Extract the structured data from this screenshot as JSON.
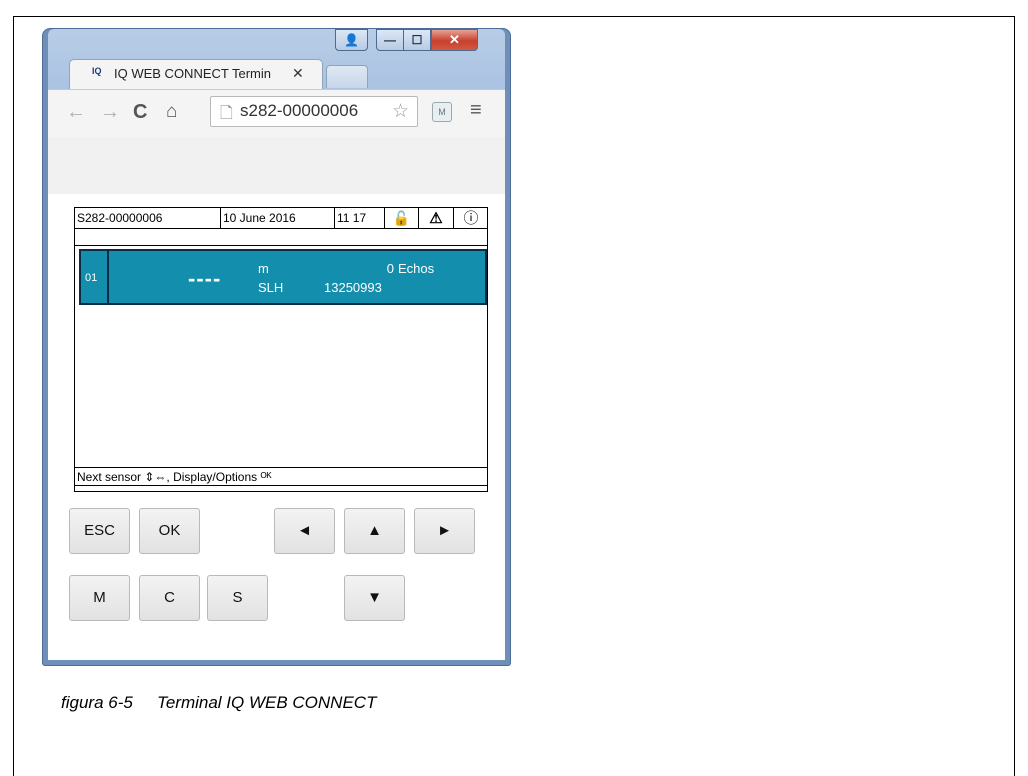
{
  "browser": {
    "tab_title": "IQ WEB CONNECT Termin",
    "favicon_text": "IQ",
    "url": "s282-00000006",
    "window_controls": [
      "user-icon",
      "minimize-icon",
      "maximize-icon",
      "close-icon"
    ]
  },
  "terminal": {
    "header": {
      "device_id": "S282-00000006",
      "date": "10 June 2016",
      "time": "11 17"
    },
    "sensor": {
      "number": "01",
      "value": "----",
      "unit_main": "m",
      "unit_sub": "SLH",
      "reading_main": "0",
      "reading_label": "Echos",
      "serial": "13250993"
    },
    "footer_text": "Next sensor ⇕⇔, Display/Options ᴼᴷ"
  },
  "keys": {
    "esc": "ESC",
    "ok": "OK",
    "left": "◄",
    "up": "▲",
    "right": "►",
    "m": "M",
    "c": "C",
    "s": "S",
    "down": "▼"
  },
  "caption": {
    "number": "figura 6-5",
    "title": "Terminal IQ WEB CONNECT"
  }
}
